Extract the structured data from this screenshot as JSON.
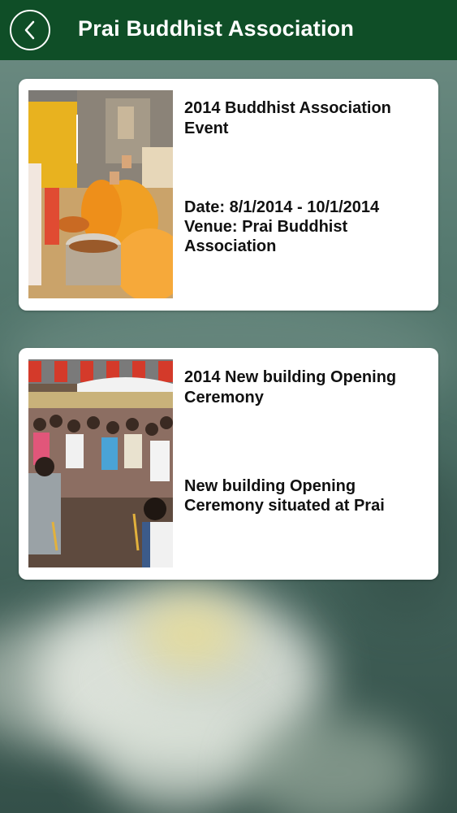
{
  "header": {
    "title": "Prai Buddhist Association",
    "back_icon": "chevron-left-icon"
  },
  "events": [
    {
      "title": "2014 Buddhist Association Event",
      "date_line": "Date: 8/1/2014 - 10/1/2014",
      "venue_line": "Venue: Prai Buddhist Association",
      "image": "monks-ceremony-photo"
    },
    {
      "title": "2014 New building Opening Ceremony",
      "description": "New building Opening Ceremony situated at Prai",
      "image": "crowd-ceremony-photo"
    }
  ],
  "colors": {
    "header_bg": "#0f4e27",
    "header_text": "#ffffff",
    "card_bg": "#ffffff",
    "card_text": "#111111"
  }
}
